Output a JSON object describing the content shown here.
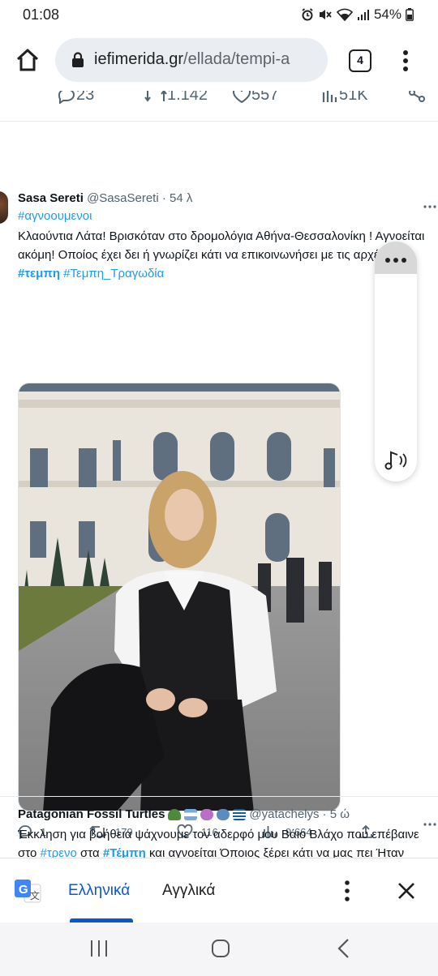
{
  "status_bar": {
    "time": "01:08",
    "battery": "54%"
  },
  "browser": {
    "url_domain": "iefimerida.gr",
    "url_path": "/ellada/tempi-a",
    "tab_count": "4"
  },
  "previous_tweet_stats": {
    "replies": "23",
    "retweets": "1.142",
    "likes": "557",
    "views": "51K"
  },
  "tweet1": {
    "author_name": "Sasa Sereti",
    "author_handle": "@SasaSereti",
    "time": "· 54 λ",
    "hashtag_line": "#αγνοουμενοι",
    "text_part1": "Κλαούντια Λάτα! Βρισκόταν στο δρομολόγια Αθήνα-Θεσσαλονίκη ! Αγνοείται ακόμη! Οποίος έχει δει ή γνωρίζει κάτι να επικοινωνήσει με τις αρχές ! ",
    "tag1": "#τεμπη",
    "tag2": "#Τεμπη_Τραγωδία",
    "replies": "1",
    "retweets": "179",
    "likes": "116",
    "views": "9.664"
  },
  "tweet2": {
    "author_name": "Patagonian Fossil Turtles",
    "author_handle": "@yatachelys",
    "time": "· 5 ώ",
    "line1": "Έκκληση για βοήθεια ψάχνουμε τον αδερφό μου Βάιο Βλάχο που επέβαινε",
    "line2_a": "στο ",
    "line2_tag1": "#τρενο",
    "line2_b": " στα ",
    "line2_tag2": "#Τέμπη",
    "line2_c": " και αγνοείται Όποιος ξέρει κάτι να μας πει Ήταν"
  },
  "translate_bar": {
    "lang_source": "Ελληνικά",
    "lang_target": "Αγγλικά"
  },
  "colors": {
    "link_blue": "#1d9bf0",
    "google_blue": "#0b57d0"
  }
}
